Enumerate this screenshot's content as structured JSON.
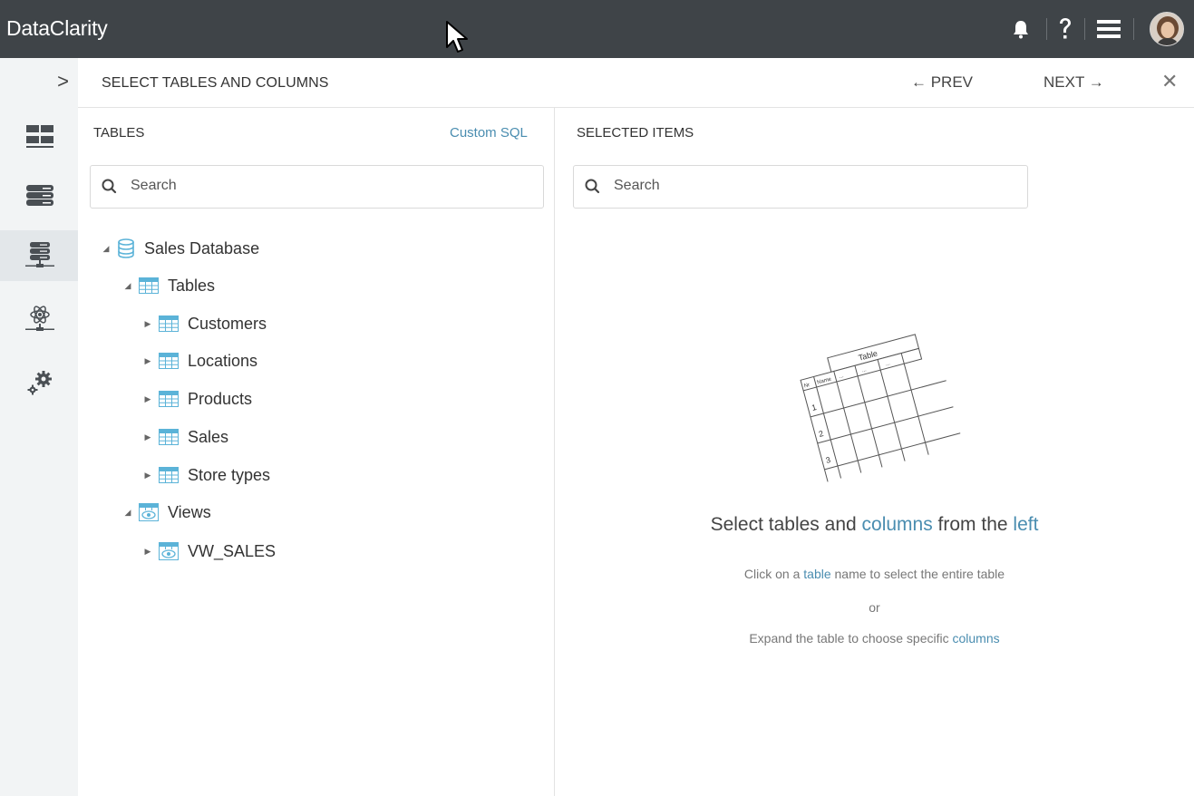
{
  "topbar": {
    "brand": "DataClarity",
    "icons": [
      "bell-icon",
      "help-icon",
      "menu-icon",
      "user-avatar"
    ]
  },
  "wizard": {
    "expand_label": ">",
    "title": "SELECT TABLES AND COLUMNS",
    "prev_label": "← PREV",
    "next_label": "NEXT →",
    "close_label": "✕"
  },
  "rail": {
    "items": [
      "dashboard-icon",
      "datasets-icon",
      "database-server-icon",
      "science-model-icon",
      "settings-icon"
    ],
    "active_index": 2
  },
  "tables_panel": {
    "heading": "TABLES",
    "custom_sql": "Custom SQL",
    "search_placeholder": "Search",
    "tree": {
      "database": "Sales Database",
      "tables_group": "Tables",
      "tables": [
        "Customers",
        "Locations",
        "Products",
        "Sales",
        "Store types"
      ],
      "views_group": "Views",
      "views": [
        "VW_SALES"
      ]
    }
  },
  "selected_panel": {
    "heading": "SELECTED ITEMS",
    "search_placeholder": "Search",
    "illustration": {
      "title": "Table",
      "columns": [
        "Nr",
        "Name",
        "...",
        "...",
        "..."
      ],
      "rows": [
        "1",
        "2",
        "3"
      ]
    },
    "empty_title_parts": [
      "Select tables and ",
      "columns",
      " from the ",
      "left"
    ],
    "line1_parts": [
      "Click on a ",
      "table",
      " name to select the entire table"
    ],
    "line2": "or",
    "line3_parts": [
      "Expand the table to choose specific ",
      "columns"
    ]
  },
  "colors": {
    "topbar": "#3f4448",
    "accent": "#4a8db0",
    "table_icon": "#5bb3d8"
  }
}
